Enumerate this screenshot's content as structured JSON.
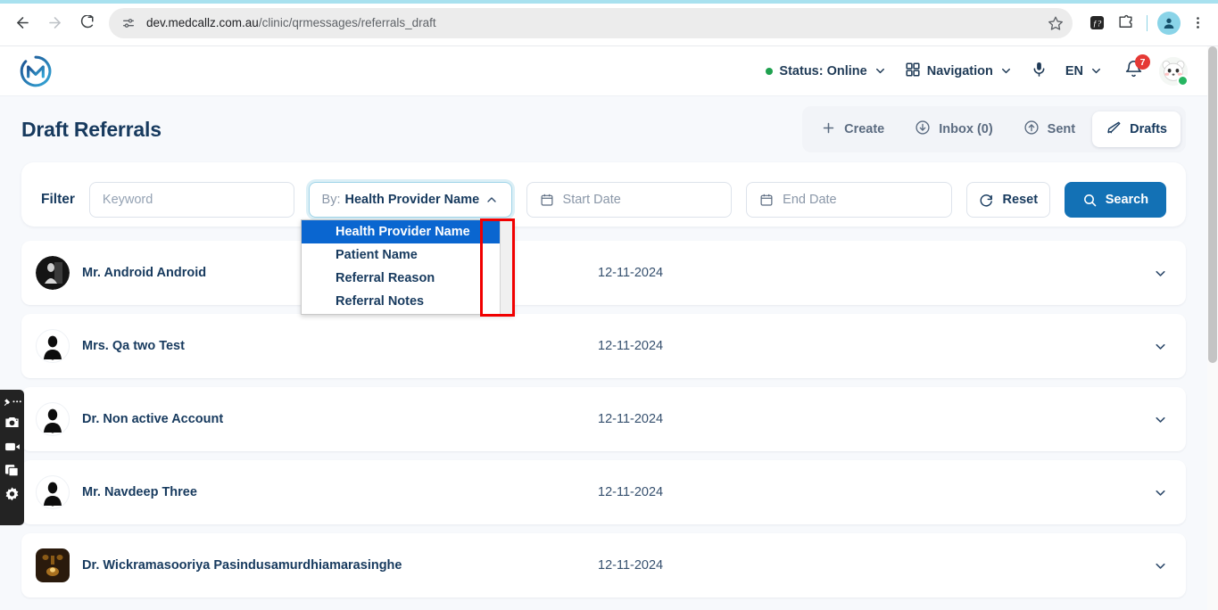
{
  "browser": {
    "back_icon": "back-arrow-icon",
    "forward_icon": "forward-arrow-icon",
    "reload_icon": "reload-icon",
    "site_info_icon": "site-settings-icon",
    "url_domain": "dev.medcallz.com.au",
    "url_path": "/clinic/qrmessages/referrals_draft",
    "star_icon": "bookmark-star-icon",
    "extension_icon": "function-extension-icon",
    "puzzle_icon": "extensions-puzzle-icon",
    "profile_icon": "profile-avatar-icon",
    "menu_icon": "kebab-menu-icon"
  },
  "header": {
    "logo_name": "medcallz-logo",
    "status": {
      "label": "Status: Online",
      "dot_color": "#1fa14f"
    },
    "navigation": {
      "label": "Navigation",
      "icon": "grid-apps-icon"
    },
    "mic_icon": "microphone-icon",
    "language": {
      "label": "EN"
    },
    "notifications": {
      "icon": "bell-icon",
      "count": "7",
      "badge_color": "#e53935"
    },
    "avatar": {
      "name": "user-avatar",
      "online_color": "#26b561"
    }
  },
  "page": {
    "title": "Draft Referrals",
    "tabs": [
      {
        "label": "Create",
        "icon": "plus-icon",
        "active": false
      },
      {
        "label": "Inbox (0)",
        "icon": "arrow-down-circle-icon",
        "active": false
      },
      {
        "label": "Sent",
        "icon": "arrow-up-circle-icon",
        "active": false
      },
      {
        "label": "Drafts",
        "icon": "pencil-icon",
        "active": true
      }
    ]
  },
  "filter": {
    "label": "Filter",
    "keyword_placeholder": "Keyword",
    "keyword_value": "",
    "by_prefix": "By:",
    "by_value": "Health Provider Name",
    "by_caret_icon": "chevron-up-icon",
    "start_date_placeholder": "Start Date",
    "end_date_placeholder": "End Date",
    "calendar_icon": "calendar-icon",
    "reset_label": "Reset",
    "reset_icon": "refresh-icon",
    "search_label": "Search",
    "search_icon": "search-icon",
    "search_bg": "#1371b5"
  },
  "dropdown": {
    "open": true,
    "options": [
      {
        "label": "Health Provider Name",
        "selected": true
      },
      {
        "label": "Patient Name",
        "selected": false
      },
      {
        "label": "Referral Reason",
        "selected": false
      },
      {
        "label": "Referral Notes",
        "selected": false
      }
    ],
    "selected_bg": "#0a66d0",
    "highlight_box_color": "#f10000"
  },
  "referrals": [
    {
      "name": "Mr. Android Android",
      "date": "12-11-2024",
      "avatar": "photo-avatar",
      "chevron": "chevron-down-icon"
    },
    {
      "name": "Mrs. Qa two Test",
      "date": "12-11-2024",
      "avatar": "doctor-silhouette-avatar",
      "chevron": "chevron-down-icon"
    },
    {
      "name": "Dr. Non active Account",
      "date": "12-11-2024",
      "avatar": "doctor-silhouette-avatar",
      "chevron": "chevron-down-icon"
    },
    {
      "name": "Mr. Navdeep Three",
      "date": "12-11-2024",
      "avatar": "doctor-silhouette-avatar",
      "chevron": "chevron-down-icon"
    },
    {
      "name": "Dr. Wickramasooriya Pasindusamurdhiamarasinghe",
      "date": "12-11-2024",
      "avatar": "lamp-photo-avatar",
      "chevron": "chevron-down-icon"
    }
  ],
  "recorder_toolbar": {
    "items": [
      {
        "icon": "pin-drag-icon"
      },
      {
        "icon": "screenshot-camera-icon"
      },
      {
        "icon": "video-camera-icon"
      },
      {
        "icon": "window-capture-icon"
      },
      {
        "icon": "settings-gear-icon"
      }
    ]
  }
}
